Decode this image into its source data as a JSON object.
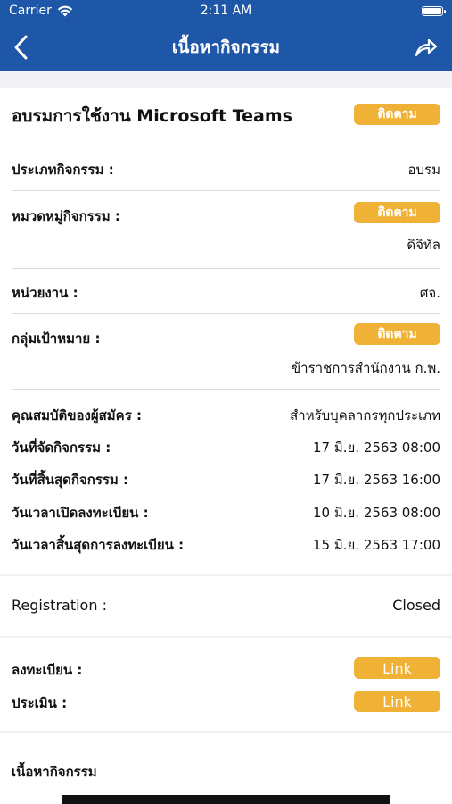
{
  "status_bar": {
    "carrier": "Carrier",
    "time": "2:11 AM"
  },
  "nav": {
    "title": "เนื้อหากิจกรรม",
    "back_icon": "chevron-left-icon",
    "share_icon": "share-arrow-icon"
  },
  "colors": {
    "header": "#1e56a8",
    "accent": "#efb236",
    "section_bg": "#f2f2f6"
  },
  "activity": {
    "title": "อบรมการใช้งาน Microsoft Teams",
    "follow_label": "ติดตาม"
  },
  "details": {
    "type_label": "ประเภทกิจกรรม :",
    "type_value": "อบรม",
    "category_label": "หมวดหมู่กิจกรรม :",
    "category_follow": "ติดตาม",
    "category_value": "ดิจิทัล",
    "unit_label": "หน่วยงาน :",
    "unit_value": "ศจ.",
    "target_label": "กลุ่มเป้าหมาย :",
    "target_follow": "ติดตาม",
    "target_value": "ข้าราชการสำนักงาน ก.พ.",
    "qualification_label": "คุณสมบัติของผู้สมัคร :",
    "qualification_value": "สำหรับบุคลากรทุกประเภท",
    "start_label": "วันที่จัดกิจกรรม :",
    "start_value": "17 มิ.ย. 2563 08:00",
    "end_label": "วันที่สิ้นสุดกิจกรรม :",
    "end_value": "17 มิ.ย. 2563 16:00",
    "reg_open_label": "วันเวลาเปิดลงทะเบียน :",
    "reg_open_value": "10 มิ.ย. 2563 08:00",
    "reg_close_label": "วันเวลาสิ้นสุดการลงทะเบียน :",
    "reg_close_value": "15 มิ.ย. 2563 17:00"
  },
  "registration": {
    "label": "Registration :",
    "value": "Closed"
  },
  "links": {
    "register_label": "ลงทะเบียน :",
    "register_button": "Link",
    "evaluate_label": "ประเมิน :",
    "evaluate_button": "Link"
  },
  "content": {
    "heading": "เนื้อหากิจกรรม"
  }
}
